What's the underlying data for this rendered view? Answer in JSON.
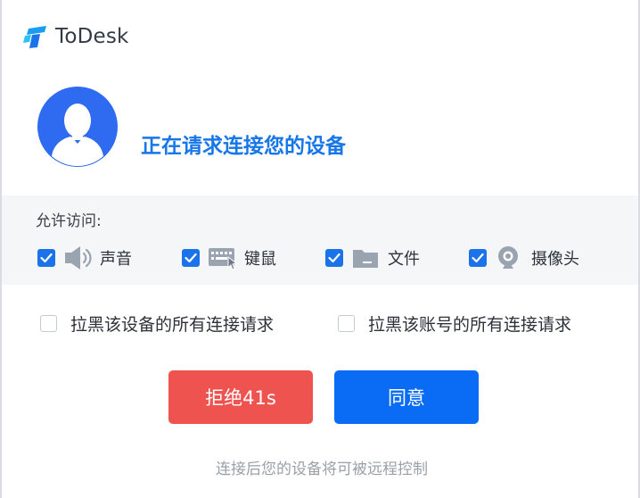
{
  "app": {
    "title": "ToDesk",
    "brand_color": "#1a73e8"
  },
  "request": {
    "title": "正在请求连接您的设备"
  },
  "permissions": {
    "label": "允许访问:",
    "items": [
      {
        "label": "声音",
        "checked": true,
        "icon": "speaker-icon"
      },
      {
        "label": "键鼠",
        "checked": true,
        "icon": "keyboard-mouse-icon"
      },
      {
        "label": "文件",
        "checked": true,
        "icon": "folder-icon"
      },
      {
        "label": "摄像头",
        "checked": true,
        "icon": "camera-icon"
      }
    ]
  },
  "blacklist": {
    "device": {
      "label": "拉黑该设备的所有连接请求",
      "checked": false
    },
    "account": {
      "label": "拉黑该账号的所有连接请求",
      "checked": false
    }
  },
  "buttons": {
    "reject": "拒绝41s",
    "accept": "同意",
    "reject_color": "#ef5350",
    "accept_color": "#0a6cf5"
  },
  "footer": {
    "note": "连接后您的设备将可被远程控制"
  }
}
